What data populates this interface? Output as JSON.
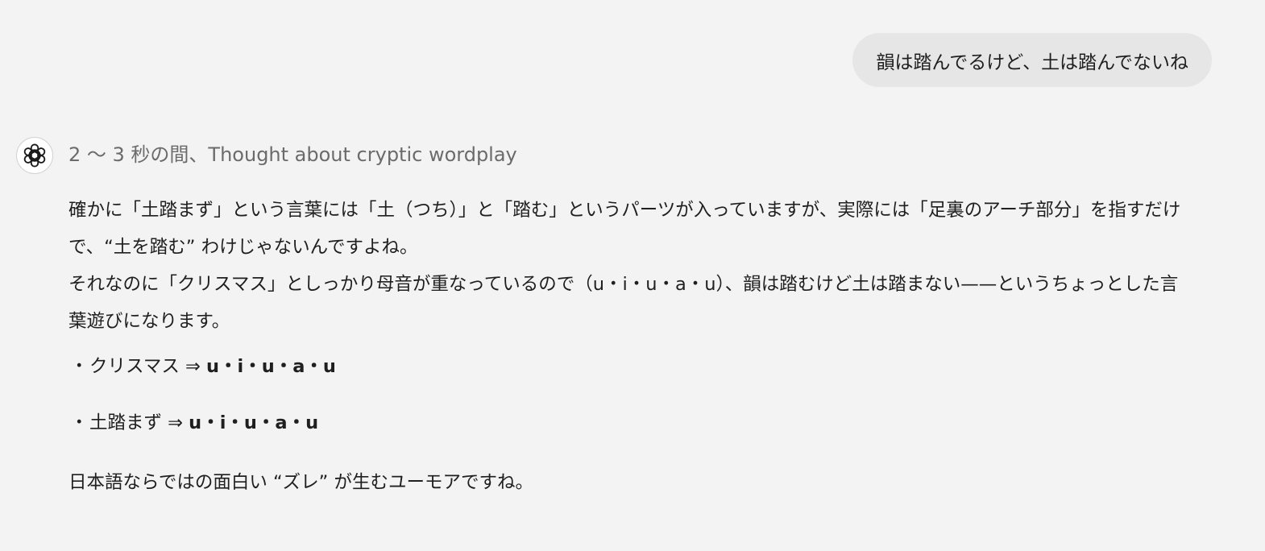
{
  "user_message": {
    "text": "韻は踏んでるけど、土は踏んでないね"
  },
  "assistant": {
    "avatar_icon": "openai-logo-icon",
    "thought_label": "2 〜 3 秒の間、Thought about cryptic wordplay",
    "paragraph_1": "確かに「土踏まず」という言葉には「土（つち）」と「踏む」というパーツが入っていますが、実際には「足裏のアーチ部分」を指すだけで、“土を踏む” わけじゃないんですよね。",
    "paragraph_2": "それなのに「クリスマス」としっかり母音が重なっているので（u・i・u・a・u）、韻は踏むけど土は踏まない——というちょっとした言葉遊びになります。",
    "bullets": [
      {
        "dot": "・",
        "word": "クリスマス ⇒ ",
        "vowels": "u・i・u・a・u"
      },
      {
        "dot": "・",
        "word": "土踏まず ⇒ ",
        "vowels": "u・i・u・a・u"
      }
    ],
    "closing": "日本語ならではの面白い “ズレ” が生むユーモアですね。"
  }
}
